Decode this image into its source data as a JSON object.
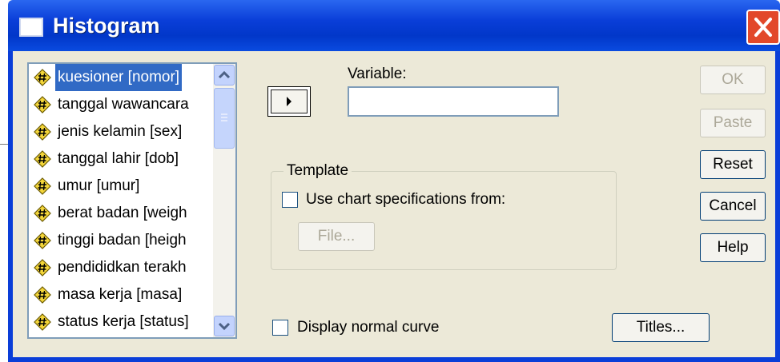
{
  "window": {
    "title": "Histogram"
  },
  "variables": {
    "items": [
      {
        "label": "kuesioner [nomor]",
        "selected": true
      },
      {
        "label": "tanggal wawancara",
        "selected": false
      },
      {
        "label": "jenis kelamin [sex]",
        "selected": false
      },
      {
        "label": "tanggal lahir [dob]",
        "selected": false
      },
      {
        "label": "umur [umur]",
        "selected": false
      },
      {
        "label": "berat badan [weigh",
        "selected": false
      },
      {
        "label": "tinggi badan [heigh",
        "selected": false
      },
      {
        "label": "pendididkan terakh",
        "selected": false
      },
      {
        "label": "masa kerja [masa]",
        "selected": false
      },
      {
        "label": "status kerja [status]",
        "selected": false
      }
    ]
  },
  "variable_field": {
    "label": "Variable:",
    "value": ""
  },
  "template": {
    "group_label": "Template",
    "use_spec_label": "Use chart specifications from:",
    "use_spec_checked": false,
    "file_button": "File..."
  },
  "normal_curve": {
    "label": "Display normal curve",
    "checked": false
  },
  "buttons": {
    "ok": "OK",
    "paste": "Paste",
    "reset": "Reset",
    "cancel": "Cancel",
    "help": "Help",
    "titles": "Titles..."
  },
  "icons": {
    "app": "window-icon",
    "close": "close-icon",
    "variable": "scale-variable-icon",
    "transfer": "right-arrow-icon"
  },
  "colors": {
    "titlebar": "#0a3ed8",
    "close": "#e2482a",
    "selection": "#316ac5",
    "dialog_bg": "#ece9d8"
  }
}
